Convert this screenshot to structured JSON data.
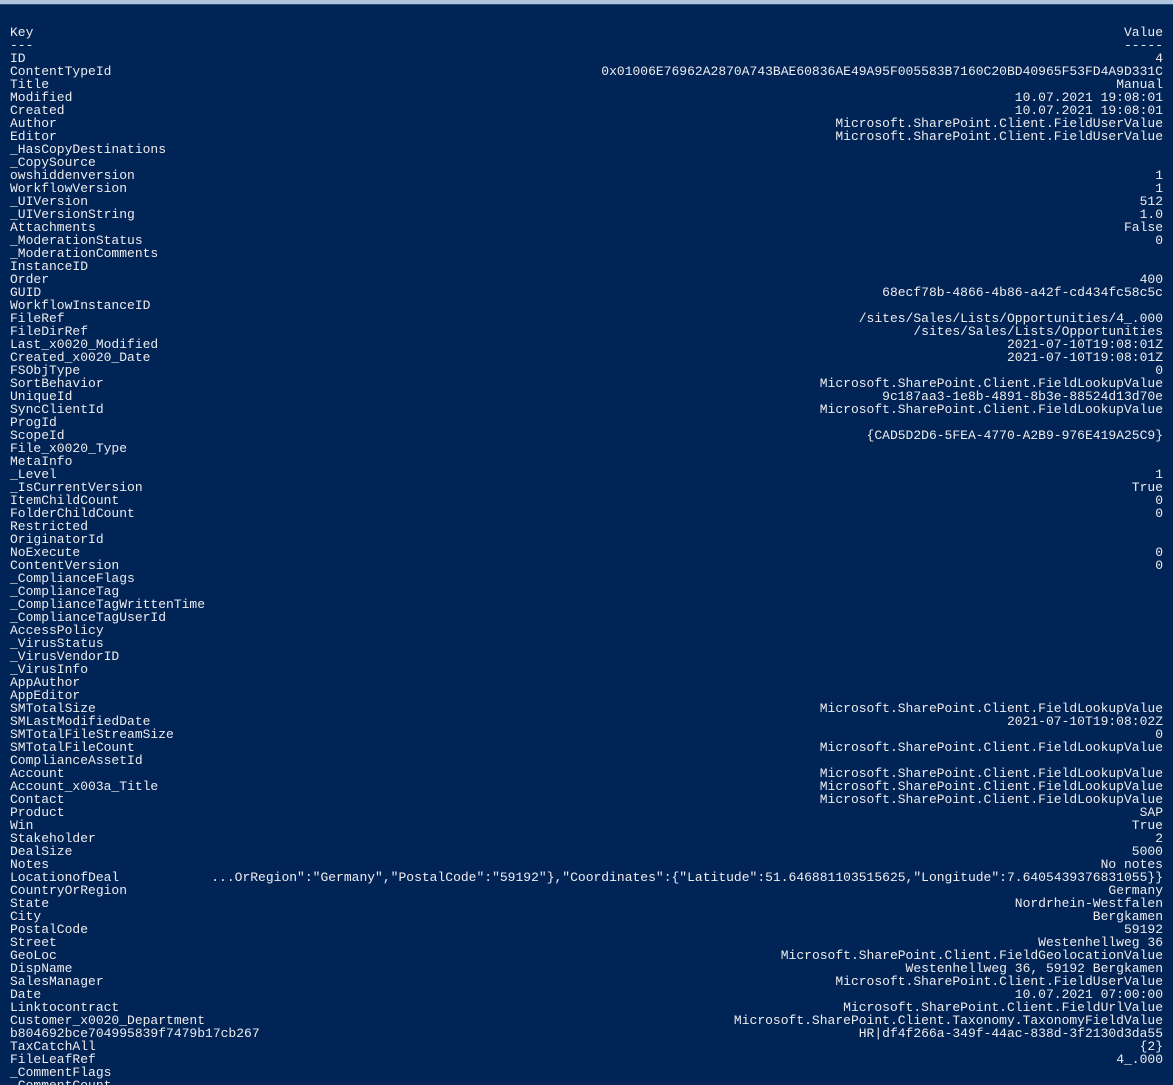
{
  "header": {
    "key_label": "Key",
    "value_label": "Value",
    "key_dash": "---",
    "value_dash": "-----"
  },
  "rows": [
    {
      "k": "ID",
      "v": "4"
    },
    {
      "k": "ContentTypeId",
      "v": "0x01006E76962A2870A743BAE60836AE49A95F005583B7160C20BD40965F53FD4A9D331C"
    },
    {
      "k": "Title",
      "v": "Manual"
    },
    {
      "k": "Modified",
      "v": "10.07.2021 19:08:01"
    },
    {
      "k": "Created",
      "v": "10.07.2021 19:08:01"
    },
    {
      "k": "Author",
      "v": "Microsoft.SharePoint.Client.FieldUserValue"
    },
    {
      "k": "Editor",
      "v": "Microsoft.SharePoint.Client.FieldUserValue"
    },
    {
      "k": "_HasCopyDestinations",
      "v": ""
    },
    {
      "k": "_CopySource",
      "v": ""
    },
    {
      "k": "owshiddenversion",
      "v": "1"
    },
    {
      "k": "WorkflowVersion",
      "v": "1"
    },
    {
      "k": "_UIVersion",
      "v": "512"
    },
    {
      "k": "_UIVersionString",
      "v": "1.0"
    },
    {
      "k": "Attachments",
      "v": "False"
    },
    {
      "k": "_ModerationStatus",
      "v": "0"
    },
    {
      "k": "_ModerationComments",
      "v": ""
    },
    {
      "k": "InstanceID",
      "v": ""
    },
    {
      "k": "Order",
      "v": "400"
    },
    {
      "k": "GUID",
      "v": "68ecf78b-4866-4b86-a42f-cd434fc58c5c"
    },
    {
      "k": "WorkflowInstanceID",
      "v": ""
    },
    {
      "k": "FileRef",
      "v": "/sites/Sales/Lists/Opportunities/4_.000"
    },
    {
      "k": "FileDirRef",
      "v": "/sites/Sales/Lists/Opportunities"
    },
    {
      "k": "Last_x0020_Modified",
      "v": "2021-07-10T19:08:01Z"
    },
    {
      "k": "Created_x0020_Date",
      "v": "2021-07-10T19:08:01Z"
    },
    {
      "k": "FSObjType",
      "v": "0"
    },
    {
      "k": "SortBehavior",
      "v": "Microsoft.SharePoint.Client.FieldLookupValue"
    },
    {
      "k": "UniqueId",
      "v": "9c187aa3-1e8b-4891-8b3e-88524d13d70e"
    },
    {
      "k": "SyncClientId",
      "v": "Microsoft.SharePoint.Client.FieldLookupValue"
    },
    {
      "k": "ProgId",
      "v": ""
    },
    {
      "k": "ScopeId",
      "v": "{CAD5D2D6-5FEA-4770-A2B9-976E419A25C9}"
    },
    {
      "k": "File_x0020_Type",
      "v": ""
    },
    {
      "k": "MetaInfo",
      "v": ""
    },
    {
      "k": "_Level",
      "v": "1"
    },
    {
      "k": "_IsCurrentVersion",
      "v": "True"
    },
    {
      "k": "ItemChildCount",
      "v": "0"
    },
    {
      "k": "FolderChildCount",
      "v": "0"
    },
    {
      "k": "Restricted",
      "v": ""
    },
    {
      "k": "OriginatorId",
      "v": ""
    },
    {
      "k": "NoExecute",
      "v": "0"
    },
    {
      "k": "ContentVersion",
      "v": "0"
    },
    {
      "k": "_ComplianceFlags",
      "v": ""
    },
    {
      "k": "_ComplianceTag",
      "v": ""
    },
    {
      "k": "_ComplianceTagWrittenTime",
      "v": ""
    },
    {
      "k": "_ComplianceTagUserId",
      "v": ""
    },
    {
      "k": "AccessPolicy",
      "v": ""
    },
    {
      "k": "_VirusStatus",
      "v": ""
    },
    {
      "k": "_VirusVendorID",
      "v": ""
    },
    {
      "k": "_VirusInfo",
      "v": ""
    },
    {
      "k": "AppAuthor",
      "v": ""
    },
    {
      "k": "AppEditor",
      "v": ""
    },
    {
      "k": "SMTotalSize",
      "v": "Microsoft.SharePoint.Client.FieldLookupValue"
    },
    {
      "k": "SMLastModifiedDate",
      "v": "2021-07-10T19:08:02Z"
    },
    {
      "k": "SMTotalFileStreamSize",
      "v": "0"
    },
    {
      "k": "SMTotalFileCount",
      "v": "Microsoft.SharePoint.Client.FieldLookupValue"
    },
    {
      "k": "ComplianceAssetId",
      "v": ""
    },
    {
      "k": "Account",
      "v": "Microsoft.SharePoint.Client.FieldLookupValue"
    },
    {
      "k": "Account_x003a_Title",
      "v": "Microsoft.SharePoint.Client.FieldLookupValue"
    },
    {
      "k": "Contact",
      "v": "Microsoft.SharePoint.Client.FieldLookupValue"
    },
    {
      "k": "Product",
      "v": "SAP"
    },
    {
      "k": "Win",
      "v": "True"
    },
    {
      "k": "Stakeholder",
      "v": "2"
    },
    {
      "k": "DealSize",
      "v": "5000"
    },
    {
      "k": "Notes",
      "v": "No notes"
    },
    {
      "k": "LocationofDeal",
      "v": "...OrRegion\":\"Germany\",\"PostalCode\":\"59192\"},\"Coordinates\":{\"Latitude\":51.646881103515625,\"Longitude\":7.6405439376831055}}"
    },
    {
      "k": "CountryOrRegion",
      "v": "Germany"
    },
    {
      "k": "State",
      "v": "Nordrhein-Westfalen"
    },
    {
      "k": "City",
      "v": "Bergkamen"
    },
    {
      "k": "PostalCode",
      "v": "59192"
    },
    {
      "k": "Street",
      "v": "Westenhellweg 36"
    },
    {
      "k": "GeoLoc",
      "v": "Microsoft.SharePoint.Client.FieldGeolocationValue"
    },
    {
      "k": "DispName",
      "v": "Westenhellweg 36, 59192 Bergkamen"
    },
    {
      "k": "SalesManager",
      "v": "Microsoft.SharePoint.Client.FieldUserValue"
    },
    {
      "k": "Date",
      "v": "10.07.2021 07:00:00"
    },
    {
      "k": "Linktocontract",
      "v": "Microsoft.SharePoint.Client.FieldUrlValue"
    },
    {
      "k": "Customer_x0020_Department",
      "v": "Microsoft.SharePoint.Client.Taxonomy.TaxonomyFieldValue"
    },
    {
      "k": "b804692bce704995839f7479b17cb267",
      "v": "HR|df4f266a-349f-44ac-838d-3f2130d3da55"
    },
    {
      "k": "TaxCatchAll",
      "v": "{2}"
    },
    {
      "k": "FileLeafRef",
      "v": "4_.000"
    },
    {
      "k": "_CommentFlags",
      "v": ""
    },
    {
      "k": "_CommentCount",
      "v": ""
    }
  ]
}
